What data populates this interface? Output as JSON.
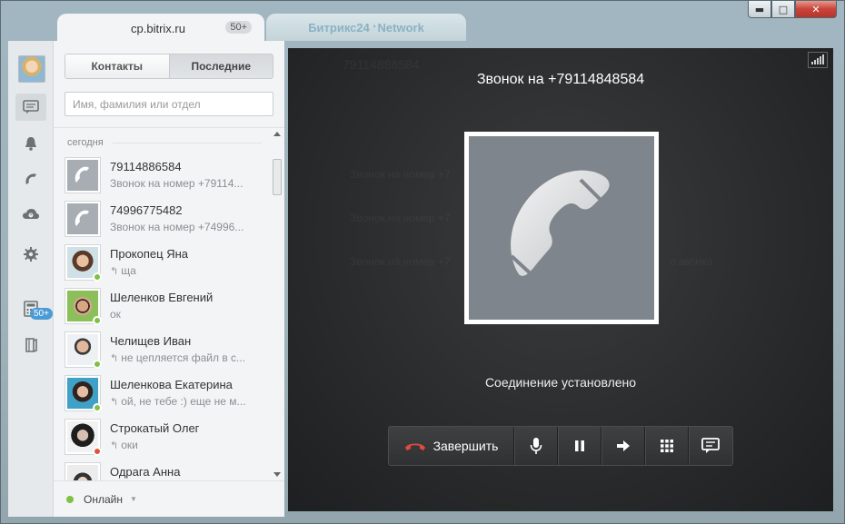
{
  "window": {
    "controls": {
      "minimize": "▬",
      "maximize": "□",
      "close": "✕"
    }
  },
  "tabs": {
    "active": {
      "label": "cp.bitrix.ru",
      "badge": "50+"
    },
    "inactive": {
      "label_prefix": "Битрикс24",
      "label_suffix": "Network",
      "circle": "◔"
    }
  },
  "iconbar": {
    "icons": [
      "user-avatar",
      "chat-icon",
      "bell-icon",
      "phone-icon",
      "cloud-icon",
      "gear-icon",
      "calculator-icon",
      "book-icon"
    ],
    "badge": "50+"
  },
  "contacts": {
    "tabs": [
      {
        "label": "Контакты",
        "selected": false
      },
      {
        "label": "Последние",
        "selected": true
      }
    ],
    "search_placeholder": "Имя, фамилия или отдел",
    "day_label": "сегодня",
    "items": [
      {
        "name": "79114886584",
        "sub": "Звонок на номер +79114...",
        "type": "phone",
        "reply": false
      },
      {
        "name": "74996775482",
        "sub": "Звонок на номер +74996...",
        "type": "phone",
        "reply": false
      },
      {
        "name": "Прокопец Яна",
        "sub": "ща",
        "type": "person",
        "status": "online",
        "reply": true
      },
      {
        "name": "Шеленков Евгений",
        "sub": "ок",
        "type": "person",
        "status": "online",
        "reply": false
      },
      {
        "name": "Челищев Иван",
        "sub": "не цепляется файл в с...",
        "type": "person",
        "status": "online",
        "reply": true
      },
      {
        "name": "Шеленкова Екатерина",
        "sub": "ой, не тебе :) еще не м...",
        "type": "person",
        "status": "online",
        "reply": true
      },
      {
        "name": "Строкатый Олег",
        "sub": "оки",
        "type": "person",
        "status": "dnd",
        "reply": true
      },
      {
        "name": "Одрага Анна",
        "sub": "",
        "type": "person",
        "status": "online",
        "reply": false
      }
    ],
    "reply_glyph": "↰",
    "status": {
      "label": "Онлайн",
      "caret": "▼"
    }
  },
  "call": {
    "title": "Звонок на +79114848584",
    "status": "Соединение установлено",
    "end_label": "Завершить",
    "ghost": {
      "number": "79114886584",
      "line1": "Звонок на номер +7",
      "line2": "Звонок на номер +7",
      "line3": "Звонок на номер +7",
      "tail": "о звонка"
    }
  }
}
